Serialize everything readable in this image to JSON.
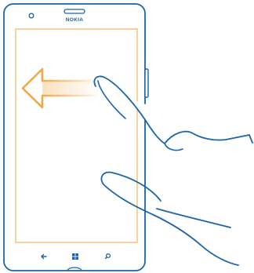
{
  "phone": {
    "brand": "NOKIA"
  },
  "gesture": {
    "type": "swipe",
    "direction": "left"
  },
  "nav_keys": [
    {
      "name": "back-key",
      "icon": "back-arrow-icon"
    },
    {
      "name": "start-key",
      "icon": "windows-logo-icon"
    },
    {
      "name": "search-key",
      "icon": "search-icon"
    }
  ],
  "colors": {
    "outline": "#1a64a8",
    "arrow": "#f0a848",
    "screen_frame": "#f0b45a",
    "background": "#ffffff"
  }
}
